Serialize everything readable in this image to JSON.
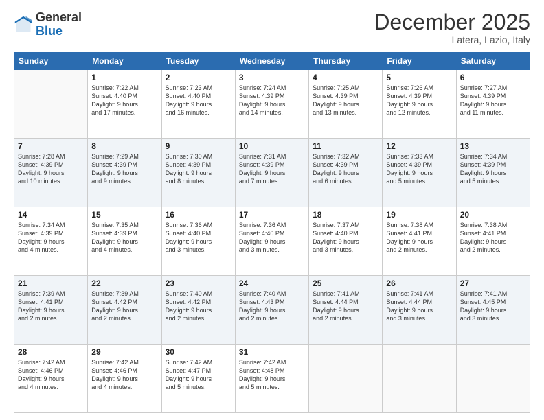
{
  "logo": {
    "general": "General",
    "blue": "Blue"
  },
  "header": {
    "month": "December 2025",
    "location": "Latera, Lazio, Italy"
  },
  "weekdays": [
    "Sunday",
    "Monday",
    "Tuesday",
    "Wednesday",
    "Thursday",
    "Friday",
    "Saturday"
  ],
  "weeks": [
    [
      {
        "day": "",
        "text": ""
      },
      {
        "day": "1",
        "text": "Sunrise: 7:22 AM\nSunset: 4:40 PM\nDaylight: 9 hours\nand 17 minutes."
      },
      {
        "day": "2",
        "text": "Sunrise: 7:23 AM\nSunset: 4:40 PM\nDaylight: 9 hours\nand 16 minutes."
      },
      {
        "day": "3",
        "text": "Sunrise: 7:24 AM\nSunset: 4:39 PM\nDaylight: 9 hours\nand 14 minutes."
      },
      {
        "day": "4",
        "text": "Sunrise: 7:25 AM\nSunset: 4:39 PM\nDaylight: 9 hours\nand 13 minutes."
      },
      {
        "day": "5",
        "text": "Sunrise: 7:26 AM\nSunset: 4:39 PM\nDaylight: 9 hours\nand 12 minutes."
      },
      {
        "day": "6",
        "text": "Sunrise: 7:27 AM\nSunset: 4:39 PM\nDaylight: 9 hours\nand 11 minutes."
      }
    ],
    [
      {
        "day": "7",
        "text": "Sunrise: 7:28 AM\nSunset: 4:39 PM\nDaylight: 9 hours\nand 10 minutes."
      },
      {
        "day": "8",
        "text": "Sunrise: 7:29 AM\nSunset: 4:39 PM\nDaylight: 9 hours\nand 9 minutes."
      },
      {
        "day": "9",
        "text": "Sunrise: 7:30 AM\nSunset: 4:39 PM\nDaylight: 9 hours\nand 8 minutes."
      },
      {
        "day": "10",
        "text": "Sunrise: 7:31 AM\nSunset: 4:39 PM\nDaylight: 9 hours\nand 7 minutes."
      },
      {
        "day": "11",
        "text": "Sunrise: 7:32 AM\nSunset: 4:39 PM\nDaylight: 9 hours\nand 6 minutes."
      },
      {
        "day": "12",
        "text": "Sunrise: 7:33 AM\nSunset: 4:39 PM\nDaylight: 9 hours\nand 5 minutes."
      },
      {
        "day": "13",
        "text": "Sunrise: 7:34 AM\nSunset: 4:39 PM\nDaylight: 9 hours\nand 5 minutes."
      }
    ],
    [
      {
        "day": "14",
        "text": "Sunrise: 7:34 AM\nSunset: 4:39 PM\nDaylight: 9 hours\nand 4 minutes."
      },
      {
        "day": "15",
        "text": "Sunrise: 7:35 AM\nSunset: 4:39 PM\nDaylight: 9 hours\nand 4 minutes."
      },
      {
        "day": "16",
        "text": "Sunrise: 7:36 AM\nSunset: 4:40 PM\nDaylight: 9 hours\nand 3 minutes."
      },
      {
        "day": "17",
        "text": "Sunrise: 7:36 AM\nSunset: 4:40 PM\nDaylight: 9 hours\nand 3 minutes."
      },
      {
        "day": "18",
        "text": "Sunrise: 7:37 AM\nSunset: 4:40 PM\nDaylight: 9 hours\nand 3 minutes."
      },
      {
        "day": "19",
        "text": "Sunrise: 7:38 AM\nSunset: 4:41 PM\nDaylight: 9 hours\nand 2 minutes."
      },
      {
        "day": "20",
        "text": "Sunrise: 7:38 AM\nSunset: 4:41 PM\nDaylight: 9 hours\nand 2 minutes."
      }
    ],
    [
      {
        "day": "21",
        "text": "Sunrise: 7:39 AM\nSunset: 4:41 PM\nDaylight: 9 hours\nand 2 minutes."
      },
      {
        "day": "22",
        "text": "Sunrise: 7:39 AM\nSunset: 4:42 PM\nDaylight: 9 hours\nand 2 minutes."
      },
      {
        "day": "23",
        "text": "Sunrise: 7:40 AM\nSunset: 4:42 PM\nDaylight: 9 hours\nand 2 minutes."
      },
      {
        "day": "24",
        "text": "Sunrise: 7:40 AM\nSunset: 4:43 PM\nDaylight: 9 hours\nand 2 minutes."
      },
      {
        "day": "25",
        "text": "Sunrise: 7:41 AM\nSunset: 4:44 PM\nDaylight: 9 hours\nand 2 minutes."
      },
      {
        "day": "26",
        "text": "Sunrise: 7:41 AM\nSunset: 4:44 PM\nDaylight: 9 hours\nand 3 minutes."
      },
      {
        "day": "27",
        "text": "Sunrise: 7:41 AM\nSunset: 4:45 PM\nDaylight: 9 hours\nand 3 minutes."
      }
    ],
    [
      {
        "day": "28",
        "text": "Sunrise: 7:42 AM\nSunset: 4:46 PM\nDaylight: 9 hours\nand 4 minutes."
      },
      {
        "day": "29",
        "text": "Sunrise: 7:42 AM\nSunset: 4:46 PM\nDaylight: 9 hours\nand 4 minutes."
      },
      {
        "day": "30",
        "text": "Sunrise: 7:42 AM\nSunset: 4:47 PM\nDaylight: 9 hours\nand 5 minutes."
      },
      {
        "day": "31",
        "text": "Sunrise: 7:42 AM\nSunset: 4:48 PM\nDaylight: 9 hours\nand 5 minutes."
      },
      {
        "day": "",
        "text": ""
      },
      {
        "day": "",
        "text": ""
      },
      {
        "day": "",
        "text": ""
      }
    ]
  ]
}
